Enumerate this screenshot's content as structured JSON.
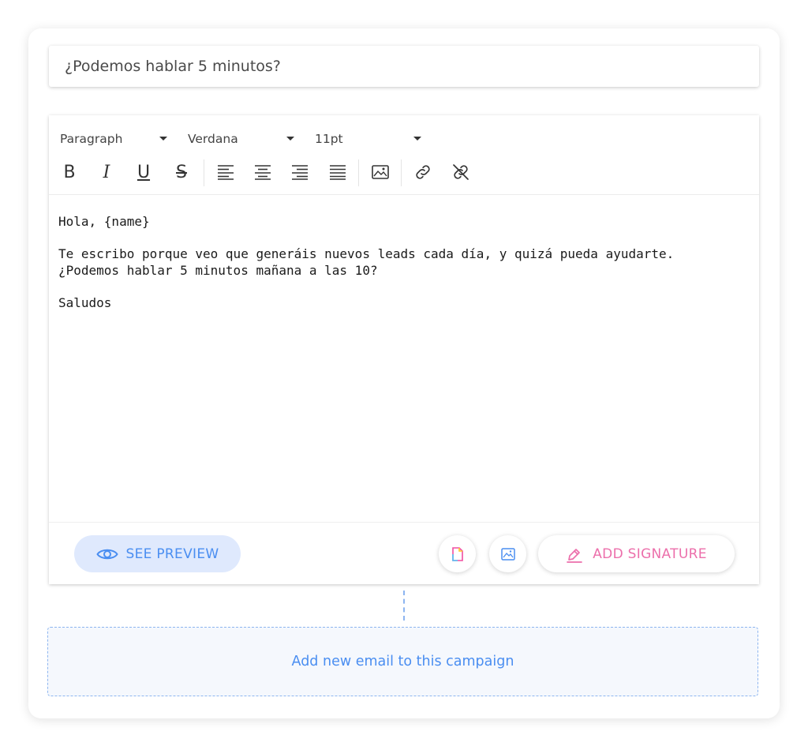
{
  "subject": {
    "value": "¿Podemos hablar 5 minutos?"
  },
  "toolbar": {
    "block_format": "Paragraph",
    "font_family": "Verdana",
    "font_size": "11pt",
    "bold": "B",
    "italic": "I",
    "underline": "U",
    "strike": "S",
    "icons": [
      "bold-icon",
      "italic-icon",
      "underline-icon",
      "strikethrough-icon",
      "align-left-icon",
      "align-center-icon",
      "align-right-icon",
      "align-justify-icon",
      "insert-image-icon",
      "insert-link-icon",
      "remove-link-icon"
    ]
  },
  "body": {
    "greeting": "Hola, {name}",
    "line1": "Te escribo porque veo que generáis nuevos leads cada día, y quizá pueda ayudarte.",
    "line2": "¿Podemos hablar 5 minutos mañana a las 10?",
    "closing": "Saludos"
  },
  "footer": {
    "preview_label": "SEE PREVIEW",
    "signature_label": "ADD SIGNATURE"
  },
  "add_email": {
    "label": "Add new email to this campaign"
  },
  "colors": {
    "accent_blue": "#4a8ef1",
    "preview_bg": "#dfe9fd",
    "signature_pink": "#ec6fab",
    "dashed_border": "#8db5f0"
  }
}
